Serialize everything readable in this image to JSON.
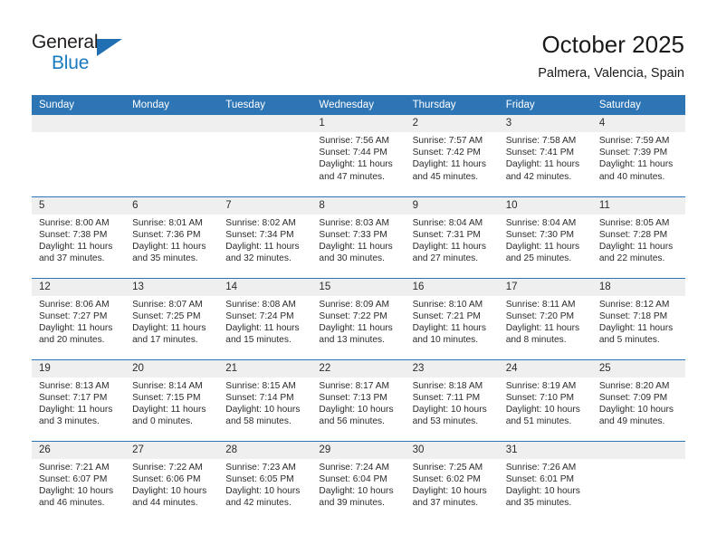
{
  "brand": {
    "name_top": "General",
    "name_bottom": "Blue",
    "logo_icon": "blue-triangle-icon"
  },
  "header": {
    "title": "October 2025",
    "location": "Palmera, Valencia, Spain"
  },
  "colors": {
    "header_row": "#2e75b6",
    "day_strip": "#efefef",
    "brand_blue": "#1a7ac0",
    "text": "#2b2b2b"
  },
  "weekday_headers": [
    "Sunday",
    "Monday",
    "Tuesday",
    "Wednesday",
    "Thursday",
    "Friday",
    "Saturday"
  ],
  "labels": {
    "sunrise_prefix": "Sunrise:",
    "sunset_prefix": "Sunset:",
    "daylight_prefix": "Daylight:"
  },
  "weeks": [
    [
      {
        "day": "",
        "empty": true
      },
      {
        "day": "",
        "empty": true
      },
      {
        "day": "",
        "empty": true
      },
      {
        "day": "1",
        "sunrise": "Sunrise: 7:56 AM",
        "sunset": "Sunset: 7:44 PM",
        "daylight_line1": "Daylight: 11 hours",
        "daylight_line2": "and 47 minutes."
      },
      {
        "day": "2",
        "sunrise": "Sunrise: 7:57 AM",
        "sunset": "Sunset: 7:42 PM",
        "daylight_line1": "Daylight: 11 hours",
        "daylight_line2": "and 45 minutes."
      },
      {
        "day": "3",
        "sunrise": "Sunrise: 7:58 AM",
        "sunset": "Sunset: 7:41 PM",
        "daylight_line1": "Daylight: 11 hours",
        "daylight_line2": "and 42 minutes."
      },
      {
        "day": "4",
        "sunrise": "Sunrise: 7:59 AM",
        "sunset": "Sunset: 7:39 PM",
        "daylight_line1": "Daylight: 11 hours",
        "daylight_line2": "and 40 minutes."
      }
    ],
    [
      {
        "day": "5",
        "sunrise": "Sunrise: 8:00 AM",
        "sunset": "Sunset: 7:38 PM",
        "daylight_line1": "Daylight: 11 hours",
        "daylight_line2": "and 37 minutes."
      },
      {
        "day": "6",
        "sunrise": "Sunrise: 8:01 AM",
        "sunset": "Sunset: 7:36 PM",
        "daylight_line1": "Daylight: 11 hours",
        "daylight_line2": "and 35 minutes."
      },
      {
        "day": "7",
        "sunrise": "Sunrise: 8:02 AM",
        "sunset": "Sunset: 7:34 PM",
        "daylight_line1": "Daylight: 11 hours",
        "daylight_line2": "and 32 minutes."
      },
      {
        "day": "8",
        "sunrise": "Sunrise: 8:03 AM",
        "sunset": "Sunset: 7:33 PM",
        "daylight_line1": "Daylight: 11 hours",
        "daylight_line2": "and 30 minutes."
      },
      {
        "day": "9",
        "sunrise": "Sunrise: 8:04 AM",
        "sunset": "Sunset: 7:31 PM",
        "daylight_line1": "Daylight: 11 hours",
        "daylight_line2": "and 27 minutes."
      },
      {
        "day": "10",
        "sunrise": "Sunrise: 8:04 AM",
        "sunset": "Sunset: 7:30 PM",
        "daylight_line1": "Daylight: 11 hours",
        "daylight_line2": "and 25 minutes."
      },
      {
        "day": "11",
        "sunrise": "Sunrise: 8:05 AM",
        "sunset": "Sunset: 7:28 PM",
        "daylight_line1": "Daylight: 11 hours",
        "daylight_line2": "and 22 minutes."
      }
    ],
    [
      {
        "day": "12",
        "sunrise": "Sunrise: 8:06 AM",
        "sunset": "Sunset: 7:27 PM",
        "daylight_line1": "Daylight: 11 hours",
        "daylight_line2": "and 20 minutes."
      },
      {
        "day": "13",
        "sunrise": "Sunrise: 8:07 AM",
        "sunset": "Sunset: 7:25 PM",
        "daylight_line1": "Daylight: 11 hours",
        "daylight_line2": "and 17 minutes."
      },
      {
        "day": "14",
        "sunrise": "Sunrise: 8:08 AM",
        "sunset": "Sunset: 7:24 PM",
        "daylight_line1": "Daylight: 11 hours",
        "daylight_line2": "and 15 minutes."
      },
      {
        "day": "15",
        "sunrise": "Sunrise: 8:09 AM",
        "sunset": "Sunset: 7:22 PM",
        "daylight_line1": "Daylight: 11 hours",
        "daylight_line2": "and 13 minutes."
      },
      {
        "day": "16",
        "sunrise": "Sunrise: 8:10 AM",
        "sunset": "Sunset: 7:21 PM",
        "daylight_line1": "Daylight: 11 hours",
        "daylight_line2": "and 10 minutes."
      },
      {
        "day": "17",
        "sunrise": "Sunrise: 8:11 AM",
        "sunset": "Sunset: 7:20 PM",
        "daylight_line1": "Daylight: 11 hours",
        "daylight_line2": "and 8 minutes."
      },
      {
        "day": "18",
        "sunrise": "Sunrise: 8:12 AM",
        "sunset": "Sunset: 7:18 PM",
        "daylight_line1": "Daylight: 11 hours",
        "daylight_line2": "and 5 minutes."
      }
    ],
    [
      {
        "day": "19",
        "sunrise": "Sunrise: 8:13 AM",
        "sunset": "Sunset: 7:17 PM",
        "daylight_line1": "Daylight: 11 hours",
        "daylight_line2": "and 3 minutes."
      },
      {
        "day": "20",
        "sunrise": "Sunrise: 8:14 AM",
        "sunset": "Sunset: 7:15 PM",
        "daylight_line1": "Daylight: 11 hours",
        "daylight_line2": "and 0 minutes."
      },
      {
        "day": "21",
        "sunrise": "Sunrise: 8:15 AM",
        "sunset": "Sunset: 7:14 PM",
        "daylight_line1": "Daylight: 10 hours",
        "daylight_line2": "and 58 minutes."
      },
      {
        "day": "22",
        "sunrise": "Sunrise: 8:17 AM",
        "sunset": "Sunset: 7:13 PM",
        "daylight_line1": "Daylight: 10 hours",
        "daylight_line2": "and 56 minutes."
      },
      {
        "day": "23",
        "sunrise": "Sunrise: 8:18 AM",
        "sunset": "Sunset: 7:11 PM",
        "daylight_line1": "Daylight: 10 hours",
        "daylight_line2": "and 53 minutes."
      },
      {
        "day": "24",
        "sunrise": "Sunrise: 8:19 AM",
        "sunset": "Sunset: 7:10 PM",
        "daylight_line1": "Daylight: 10 hours",
        "daylight_line2": "and 51 minutes."
      },
      {
        "day": "25",
        "sunrise": "Sunrise: 8:20 AM",
        "sunset": "Sunset: 7:09 PM",
        "daylight_line1": "Daylight: 10 hours",
        "daylight_line2": "and 49 minutes."
      }
    ],
    [
      {
        "day": "26",
        "sunrise": "Sunrise: 7:21 AM",
        "sunset": "Sunset: 6:07 PM",
        "daylight_line1": "Daylight: 10 hours",
        "daylight_line2": "and 46 minutes."
      },
      {
        "day": "27",
        "sunrise": "Sunrise: 7:22 AM",
        "sunset": "Sunset: 6:06 PM",
        "daylight_line1": "Daylight: 10 hours",
        "daylight_line2": "and 44 minutes."
      },
      {
        "day": "28",
        "sunrise": "Sunrise: 7:23 AM",
        "sunset": "Sunset: 6:05 PM",
        "daylight_line1": "Daylight: 10 hours",
        "daylight_line2": "and 42 minutes."
      },
      {
        "day": "29",
        "sunrise": "Sunrise: 7:24 AM",
        "sunset": "Sunset: 6:04 PM",
        "daylight_line1": "Daylight: 10 hours",
        "daylight_line2": "and 39 minutes."
      },
      {
        "day": "30",
        "sunrise": "Sunrise: 7:25 AM",
        "sunset": "Sunset: 6:02 PM",
        "daylight_line1": "Daylight: 10 hours",
        "daylight_line2": "and 37 minutes."
      },
      {
        "day": "31",
        "sunrise": "Sunrise: 7:26 AM",
        "sunset": "Sunset: 6:01 PM",
        "daylight_line1": "Daylight: 10 hours",
        "daylight_line2": "and 35 minutes."
      },
      {
        "day": "",
        "empty": true
      }
    ]
  ]
}
